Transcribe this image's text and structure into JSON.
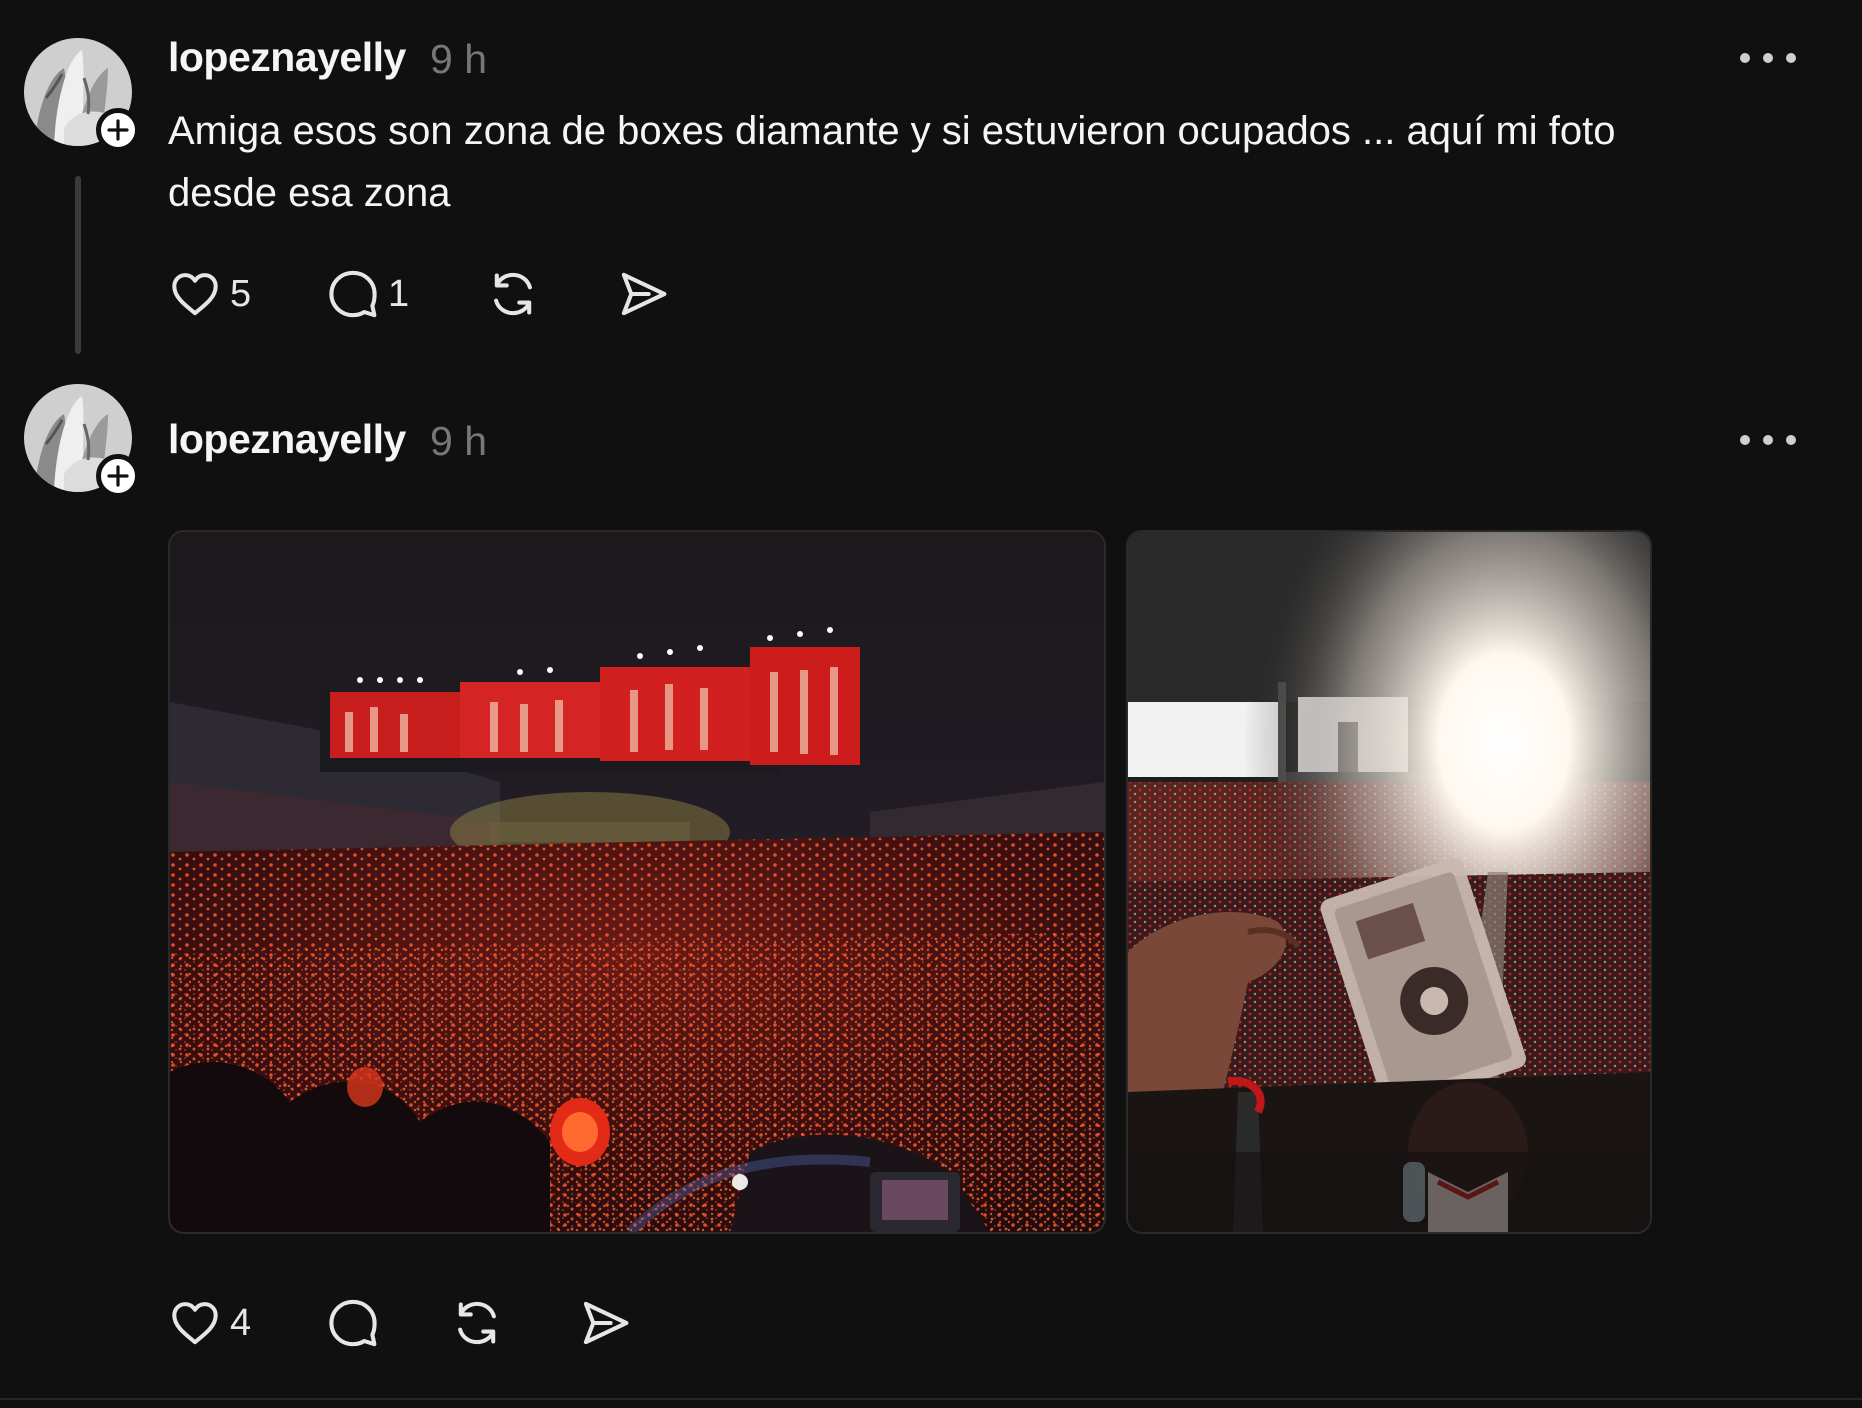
{
  "posts": [
    {
      "username": "lopeznayelly",
      "time": "9 h",
      "text": "Amiga esos son zona de boxes diamante y si estuvieron ocupados ... aquí mi foto desde esa zona",
      "likes": "5",
      "replies": "1"
    },
    {
      "username": "lopeznayelly",
      "time": "9 h",
      "likes": "4",
      "images": [
        "stadium-concert-photo",
        "concert-photocard-photo"
      ]
    }
  ],
  "icons": {
    "like": "heart-icon",
    "reply": "comment-icon",
    "repost": "repost-icon",
    "share": "send-icon",
    "more": "more-icon",
    "follow": "plus-icon"
  },
  "colors": {
    "background": "#101010",
    "text": "#f3f5f7",
    "muted": "#777777",
    "thread_line": "#3a3a3a"
  }
}
